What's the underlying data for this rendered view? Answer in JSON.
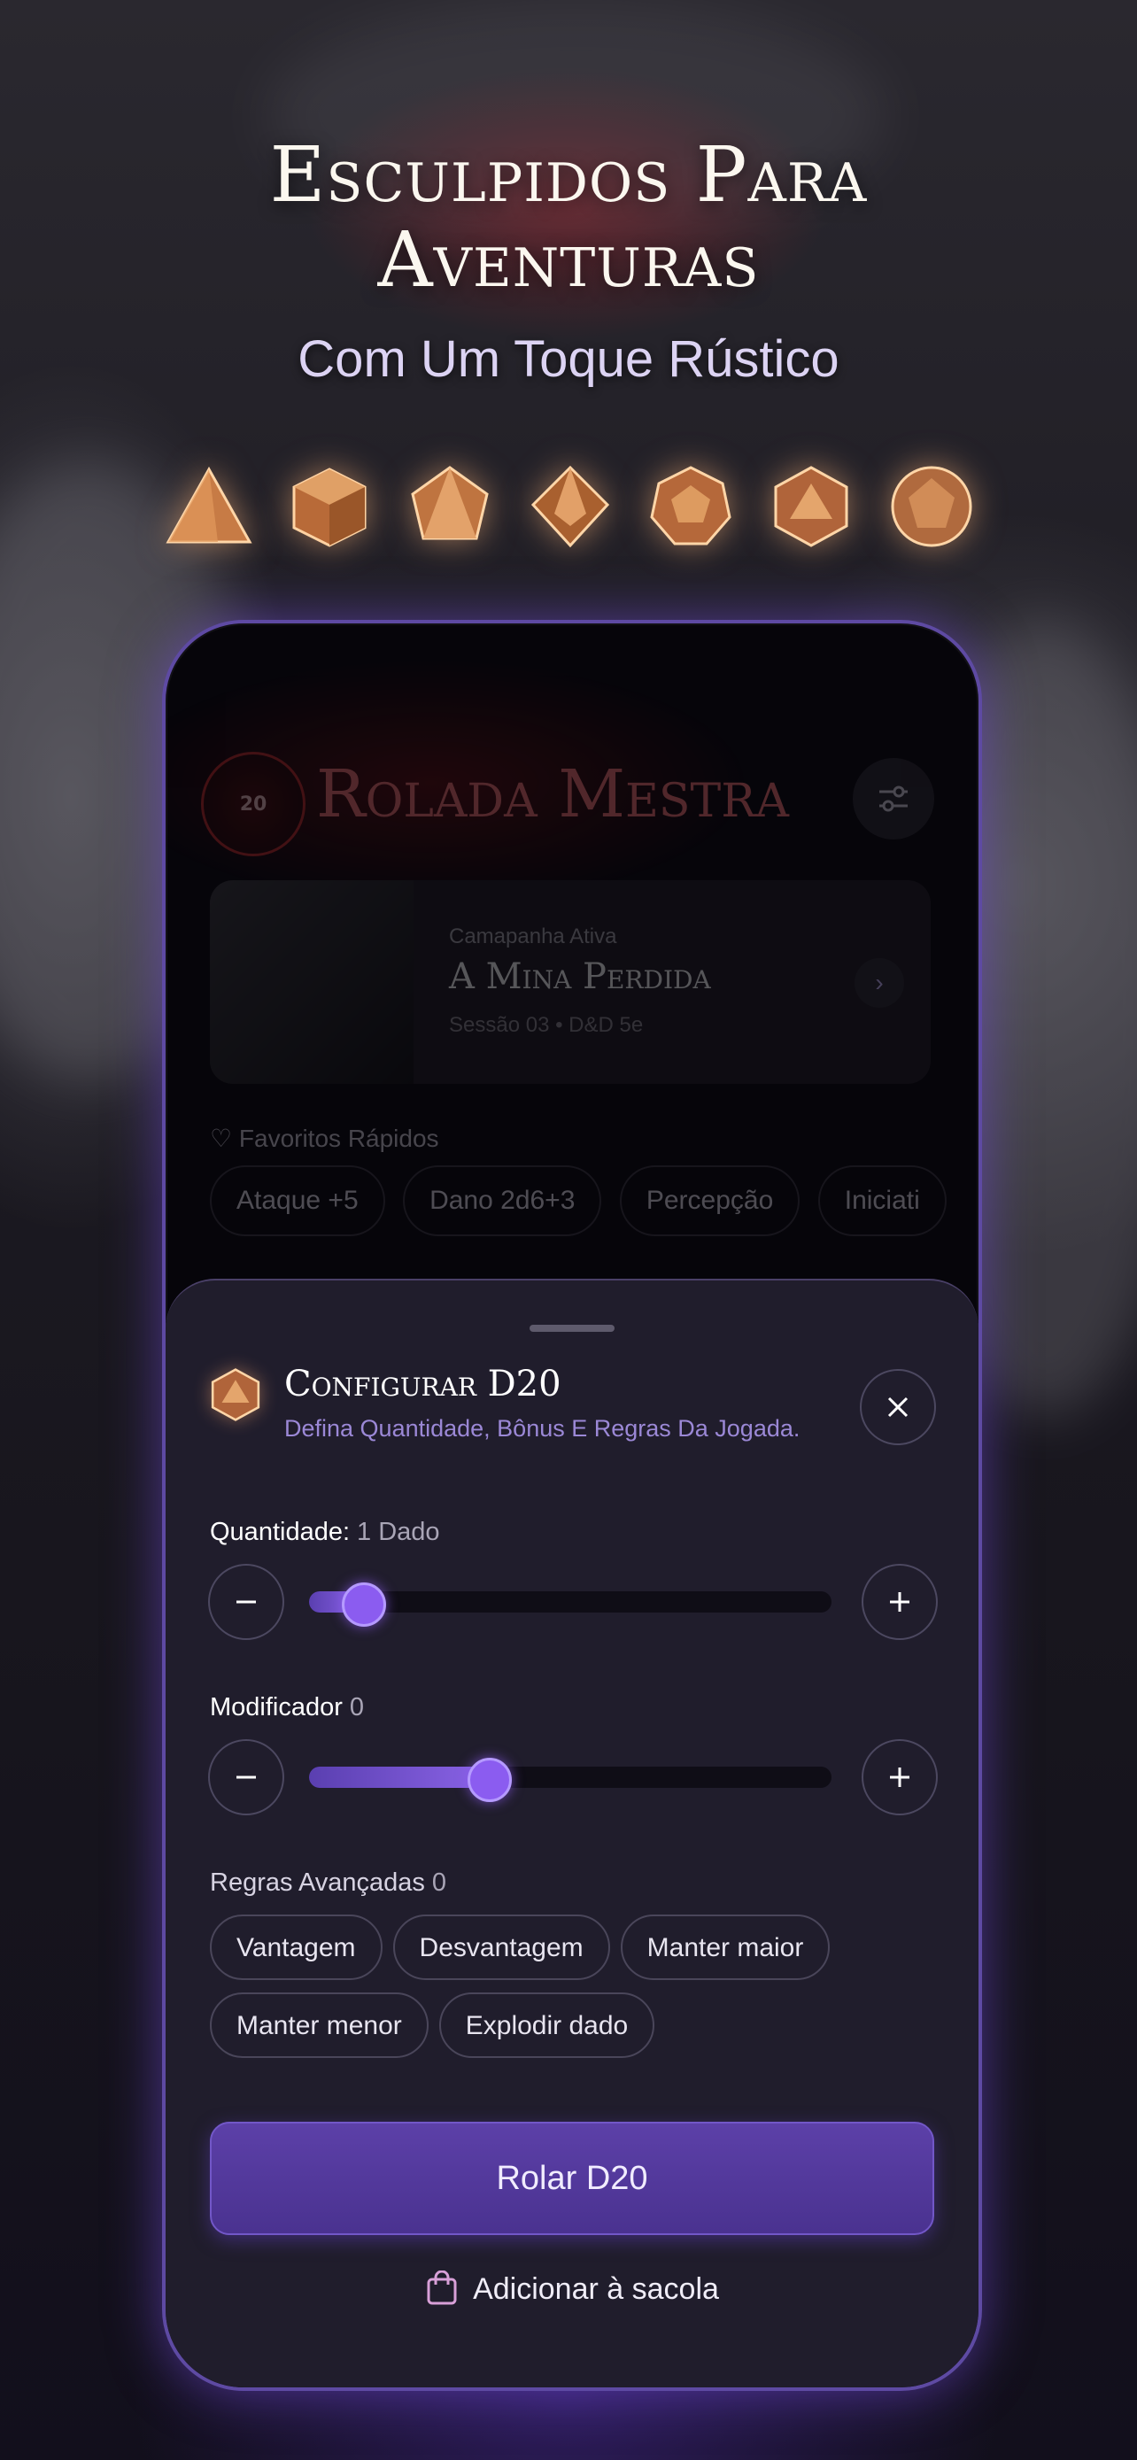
{
  "hero": {
    "title_line1": "Esculpidos Para",
    "title_line2": "Aventuras",
    "subtitle": "Com Um Toque Rústico",
    "dice_icons": [
      "d4-icon",
      "d6-icon",
      "d8-icon",
      "d10-icon",
      "d12-icon",
      "d20-icon",
      "d100-icon"
    ]
  },
  "app": {
    "logo_text": "20",
    "title": "Rolada Mestra",
    "campaign": {
      "kicker": "Camapanha Ativa",
      "title": "A Mina Perdida",
      "meta": "Sessão 03 • D&D 5e"
    },
    "favorites": {
      "label": "Favoritos Rápidos",
      "items": [
        "Ataque +5",
        "Dano 2d6+3",
        "Percepção",
        "Iniciati"
      ]
    }
  },
  "sheet": {
    "title": "Configurar D20",
    "subtitle": "Defina Quantidade, Bônus E Regras Da Jogada.",
    "quantity": {
      "label": "Quantidade:",
      "value": "1 Dado",
      "level": 0.1
    },
    "modifier": {
      "label": "Modificador",
      "value": "0",
      "level": 0.34
    },
    "rules": {
      "label": "Regras Avançadas",
      "count": "0",
      "options": [
        "Vantagem",
        "Desvantagem",
        "Manter maior",
        "Manter menor",
        "Explodir dado"
      ]
    },
    "roll_button": "Rolar D20",
    "bag_link": "Adicionar à sacola"
  },
  "colors": {
    "accent": "#8b5cf0",
    "sheet_bg": "#201d2c",
    "brand_red": "#c22b2b"
  }
}
